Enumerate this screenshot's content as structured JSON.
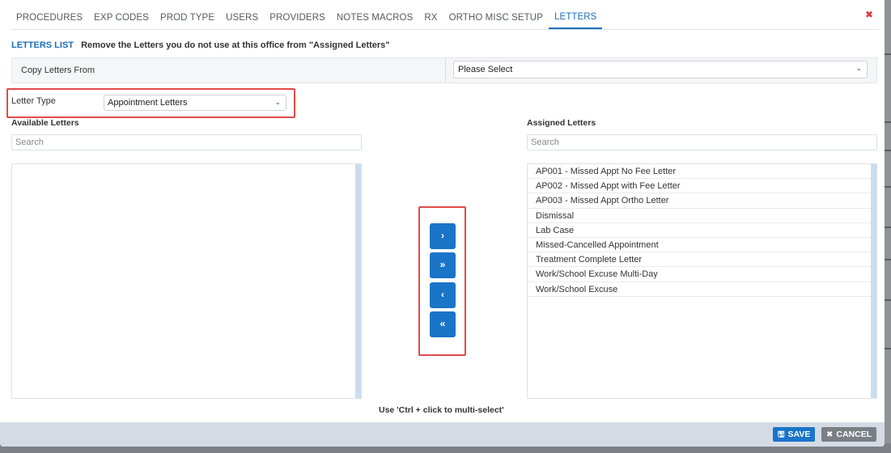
{
  "tabs": [
    {
      "label": "PROCEDURES",
      "active": false
    },
    {
      "label": "EXP CODES",
      "active": false
    },
    {
      "label": "PROD TYPE",
      "active": false
    },
    {
      "label": "USERS",
      "active": false
    },
    {
      "label": "PROVIDERS",
      "active": false
    },
    {
      "label": "NOTES MACROS",
      "active": false
    },
    {
      "label": "RX",
      "active": false
    },
    {
      "label": "ORTHO MISC SETUP",
      "active": false
    },
    {
      "label": "LETTERS",
      "active": true
    }
  ],
  "close_glyph": "✖",
  "letters_list": {
    "title": "LETTERS LIST",
    "description": "Remove the Letters you do not use at this office from \"Assigned Letters\""
  },
  "copy_from": {
    "label": "Copy Letters From",
    "selected": "Please Select"
  },
  "letter_type": {
    "label": "Letter Type",
    "selected": "Appointment Letters"
  },
  "available": {
    "label": "Available Letters",
    "search_placeholder": "Search",
    "items": []
  },
  "assigned": {
    "label": "Assigned Letters",
    "search_placeholder": "Search",
    "items": [
      "AP001 - Missed Appt No Fee Letter",
      "AP002 - Missed Appt with Fee Letter",
      "AP003 - Missed Appt Ortho Letter",
      "Dismissal",
      "Lab Case",
      "Missed-Cancelled Appointment",
      "Treatment Complete Letter",
      "Work/School Excuse Multi-Day",
      "Work/School Excuse"
    ]
  },
  "move_buttons": {
    "move_right": "›",
    "move_all_right": "»",
    "move_left": "‹",
    "move_all_left": "«"
  },
  "hint": "Use 'Ctrl + click to multi-select'",
  "footer": {
    "save_label": "SAVE",
    "cancel_label": "CANCEL"
  },
  "icons": {
    "chevron": "⌄",
    "save": "🖫",
    "cancel": "✖"
  },
  "colors": {
    "accent": "#1a74c8",
    "highlight_box": "#e14b4b",
    "close": "#d43a3a"
  }
}
